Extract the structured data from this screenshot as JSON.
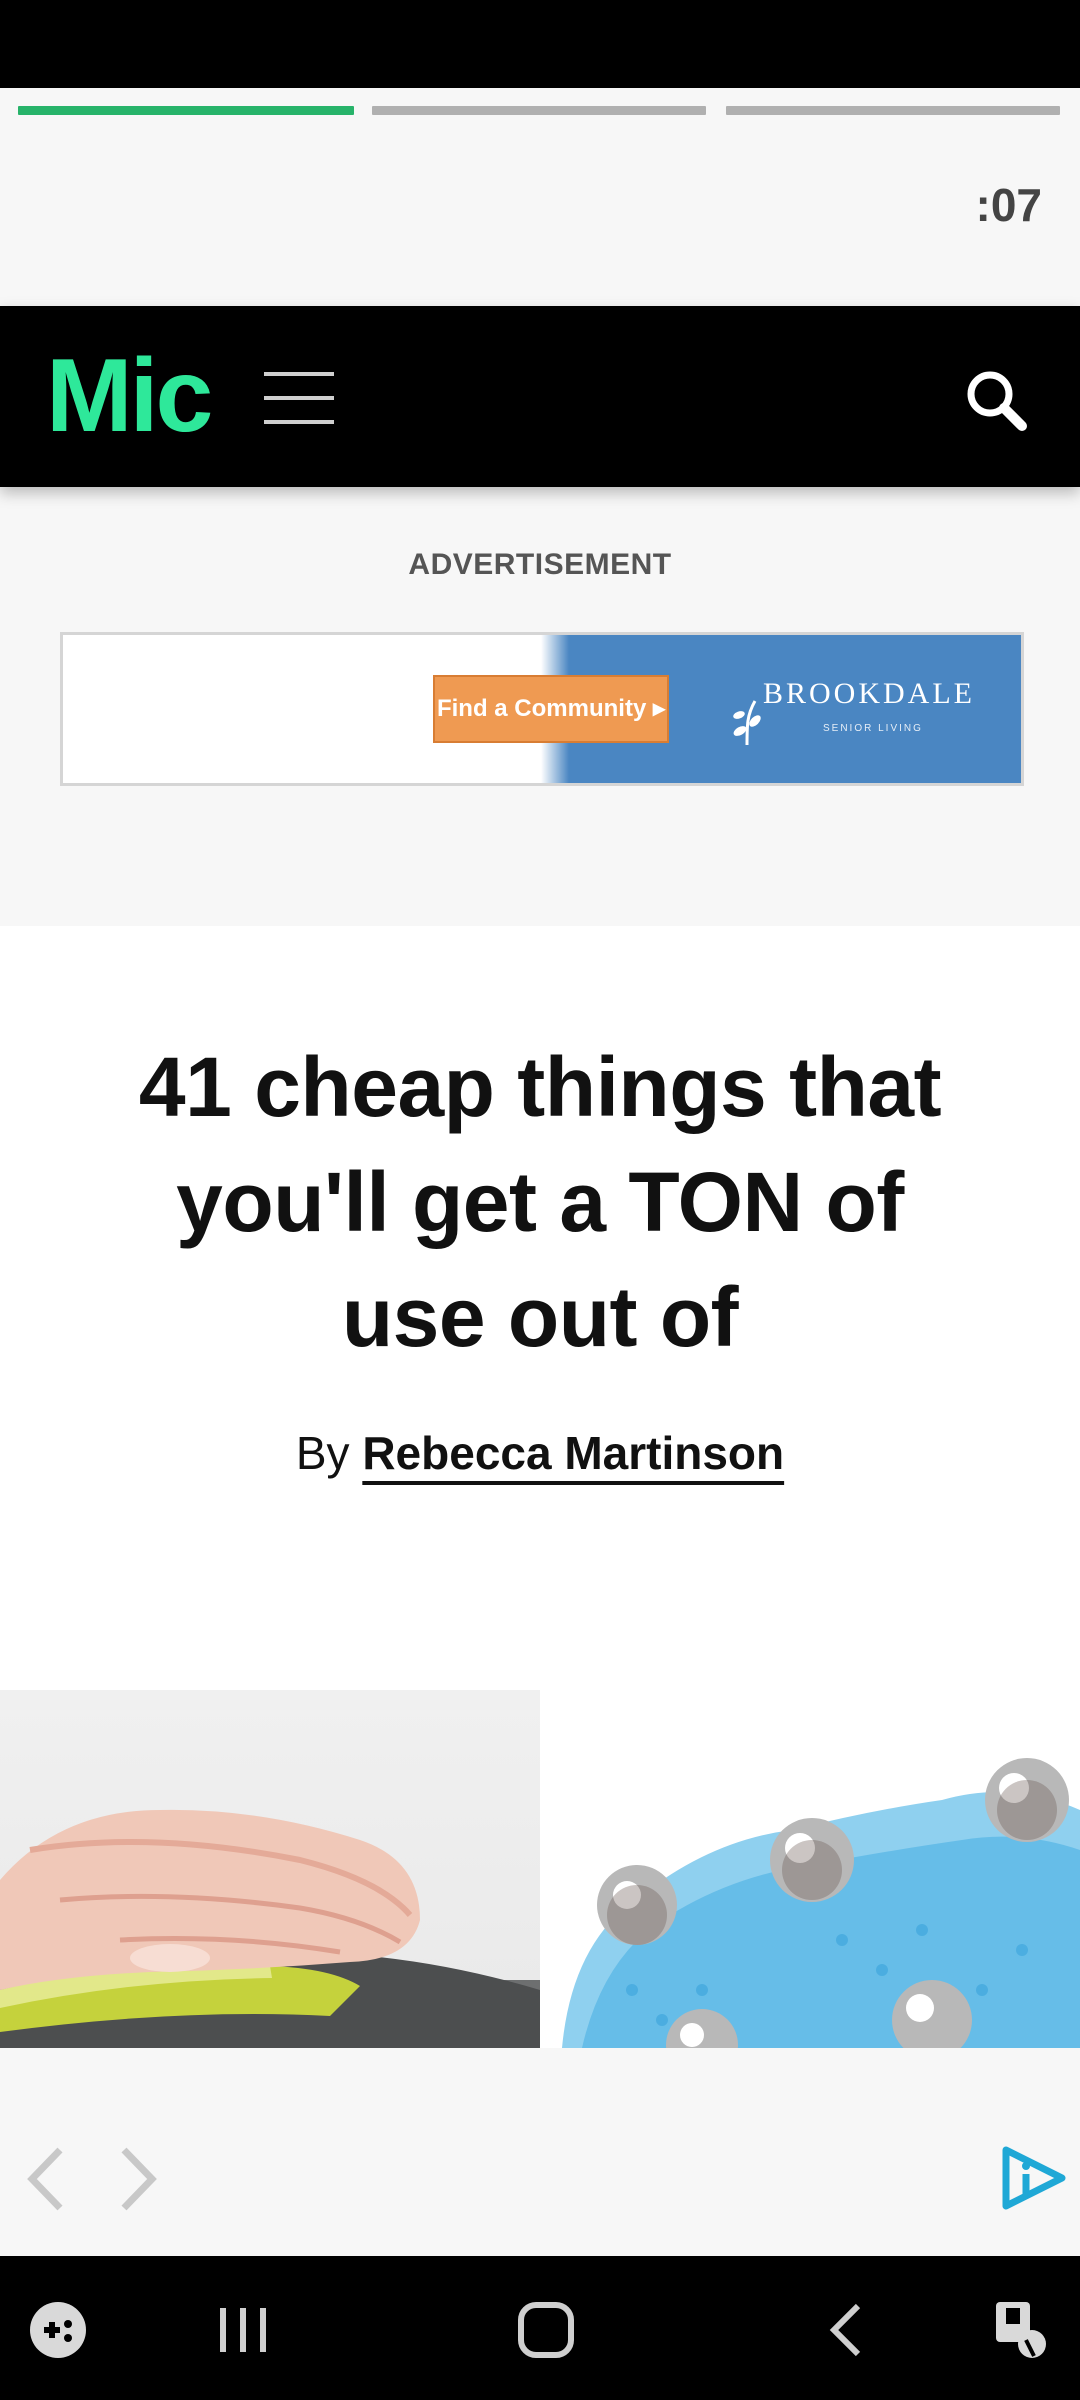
{
  "story": {
    "segments": [
      {
        "state": "active"
      },
      {
        "state": "inactive"
      },
      {
        "state": "inactive"
      }
    ],
    "timer": ":07"
  },
  "header": {
    "logo": "Mic",
    "menu_icon": "hamburger-icon",
    "search_icon": "search-icon"
  },
  "ad": {
    "label": "ADVERTISEMENT",
    "cta": "Find a Community ▸",
    "brand": "BROOKDALE",
    "brand_sub": "SENIOR LIVING"
  },
  "article": {
    "title": "41 cheap things that you'll get a TON of use out of",
    "byline_prefix": "By",
    "author": "Rebecca Martinson"
  },
  "bottom": {
    "prev_icon": "chevron-left-icon",
    "next_icon": "chevron-right-icon",
    "logo_icon": "play-info-icon"
  },
  "colors": {
    "accent_green": "#2ee89a",
    "progress_green": "#27b36a",
    "ad_blue": "#4a86c2",
    "ad_orange": "#ef9a52",
    "logo_cyan": "#1fa8d6"
  }
}
